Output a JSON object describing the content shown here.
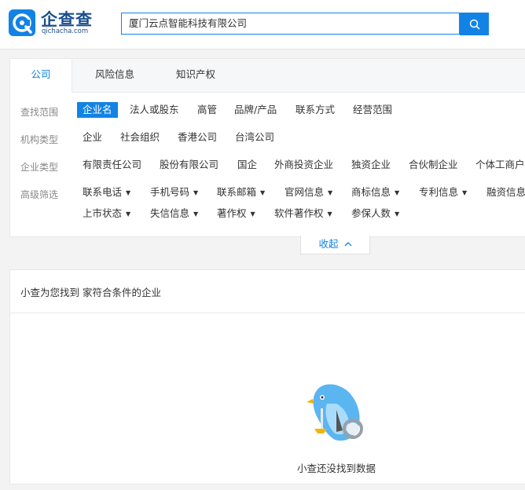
{
  "header": {
    "logo_text": "企查查",
    "logo_sub": "qichacha.com",
    "search_value": "厦门云点智能科技有限公司"
  },
  "tabs": [
    {
      "label": "公司",
      "active": true
    },
    {
      "label": "风险信息",
      "active": false
    },
    {
      "label": "知识产权",
      "active": false
    }
  ],
  "filters": {
    "scope": {
      "label": "查找范围",
      "options": [
        {
          "label": "企业名",
          "selected": true
        },
        {
          "label": "法人或股东"
        },
        {
          "label": "高管"
        },
        {
          "label": "品牌/产品"
        },
        {
          "label": "联系方式"
        },
        {
          "label": "经营范围"
        }
      ]
    },
    "org_type": {
      "label": "机构类型",
      "options": [
        {
          "label": "企业"
        },
        {
          "label": "社会组织"
        },
        {
          "label": "香港公司"
        },
        {
          "label": "台湾公司"
        }
      ]
    },
    "company_type": {
      "label": "企业类型",
      "options": [
        {
          "label": "有限责任公司"
        },
        {
          "label": "股份有限公司"
        },
        {
          "label": "国企"
        },
        {
          "label": "外商投资企业"
        },
        {
          "label": "独资企业"
        },
        {
          "label": "合伙制企业"
        },
        {
          "label": "个体工商户"
        }
      ]
    },
    "advanced": {
      "label": "高级筛选",
      "row1": [
        {
          "label": "联系电话"
        },
        {
          "label": "手机号码"
        },
        {
          "label": "联系邮箱"
        },
        {
          "label": "官网信息"
        },
        {
          "label": "商标信息"
        },
        {
          "label": "专利信息"
        },
        {
          "label": "融资信息"
        }
      ],
      "row2": [
        {
          "label": "上市状态"
        },
        {
          "label": "失信信息"
        },
        {
          "label": "著作权"
        },
        {
          "label": "软件著作权"
        },
        {
          "label": "参保人数"
        }
      ]
    }
  },
  "collapse_label": "收起",
  "results": {
    "summary": "小查为您找到 家符合条件的企业",
    "empty_text": "小查还没找到数据"
  },
  "colors": {
    "accent": "#1283e5",
    "logo": "#1a4f8c"
  }
}
